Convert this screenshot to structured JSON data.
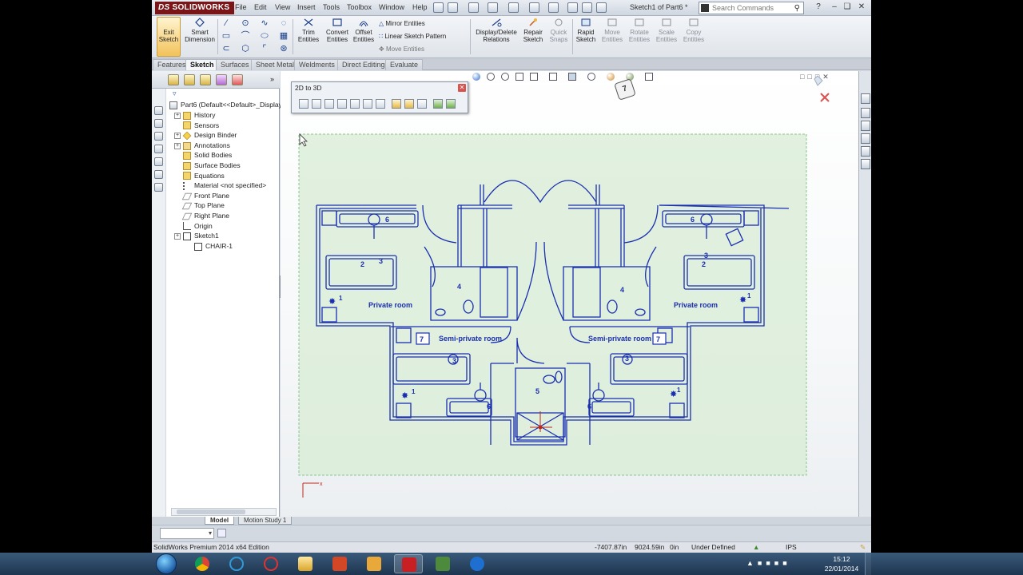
{
  "app": {
    "brand": "SOLIDWORKS",
    "brand_prefix": "DS",
    "menus": [
      "File",
      "Edit",
      "View",
      "Insert",
      "Tools",
      "Toolbox",
      "Window",
      "Help"
    ],
    "document_title": "Sketch1 of Part6 *",
    "search_placeholder": "Search Commands"
  },
  "command_manager": {
    "exit_sketch": "Exit Sketch",
    "smart_dimension": "Smart Dimension",
    "trim": "Trim Entities",
    "convert": "Convert Entities",
    "offset": "Offset Entities",
    "mirror": "Mirror Entities",
    "linear_pattern": "Linear Sketch Pattern",
    "move_entities": "Move Entities",
    "display_delete": "Display/Delete Relations",
    "repair": "Repair Sketch",
    "quick_snaps": "Quick Snaps",
    "rapid_sketch": "Rapid Sketch",
    "move": "Move Entities",
    "rotate": "Rotate Entities",
    "scale": "Scale Entities",
    "copy": "Copy Entities"
  },
  "tabs": [
    "Features",
    "Sketch",
    "Surfaces",
    "Sheet Metal",
    "Weldments",
    "Direct Editing",
    "Evaluate"
  ],
  "active_tab": "Sketch",
  "feature_tree": {
    "root": "Part6  (Default<<Default>_Display",
    "items": [
      {
        "label": "History",
        "icon": "folder-icon",
        "expandable": true
      },
      {
        "label": "Sensors",
        "icon": "folder-icon",
        "expandable": false
      },
      {
        "label": "Design Binder",
        "icon": "diamond-icon",
        "expandable": true
      },
      {
        "label": "Annotations",
        "icon": "annotations-icon",
        "expandable": true
      },
      {
        "label": "Solid Bodies",
        "icon": "folder-icon",
        "expandable": false
      },
      {
        "label": "Surface Bodies",
        "icon": "folder-icon",
        "expandable": false
      },
      {
        "label": "Equations",
        "icon": "folder-icon",
        "expandable": false
      },
      {
        "label": "Material <not specified>",
        "icon": "material-icon",
        "expandable": false
      },
      {
        "label": "Front Plane",
        "icon": "plane-icon",
        "expandable": false
      },
      {
        "label": "Top Plane",
        "icon": "plane-icon",
        "expandable": false
      },
      {
        "label": "Right Plane",
        "icon": "plane-icon",
        "expandable": false
      },
      {
        "label": "Origin",
        "icon": "origin-icon",
        "expandable": false
      },
      {
        "label": "Sketch1",
        "icon": "sketch-icon",
        "expandable": true
      },
      {
        "label": "CHAIR-1",
        "icon": "sketch-block-icon",
        "expandable": false
      }
    ]
  },
  "floating_toolbar": {
    "title": "2D to 3D"
  },
  "floor_plan": {
    "left_label": "Private room",
    "right_label": "Private room",
    "semi_left_label": "Semi-private room",
    "semi_right_label": "Semi-private room",
    "numbers": [
      "6",
      "2",
      "3",
      "1",
      "4",
      "7",
      "5"
    ]
  },
  "view_cube_label": "7",
  "bottom_tabs": [
    "Model",
    "Motion Study 1"
  ],
  "active_bottom_tab": "Model",
  "status": {
    "edition": "SolidWorks Premium 2014 x64 Edition",
    "x": "-7407.87in",
    "y": "9024.59in",
    "z": "0in",
    "state": "Under Defined",
    "units": "IPS"
  },
  "clock": {
    "time": "15:12",
    "date": "22/01/2014"
  },
  "colors": {
    "sketch_blue": "#1a2fb0",
    "selection_green": "#d8ecd4",
    "brand_red": "#7a1518"
  }
}
